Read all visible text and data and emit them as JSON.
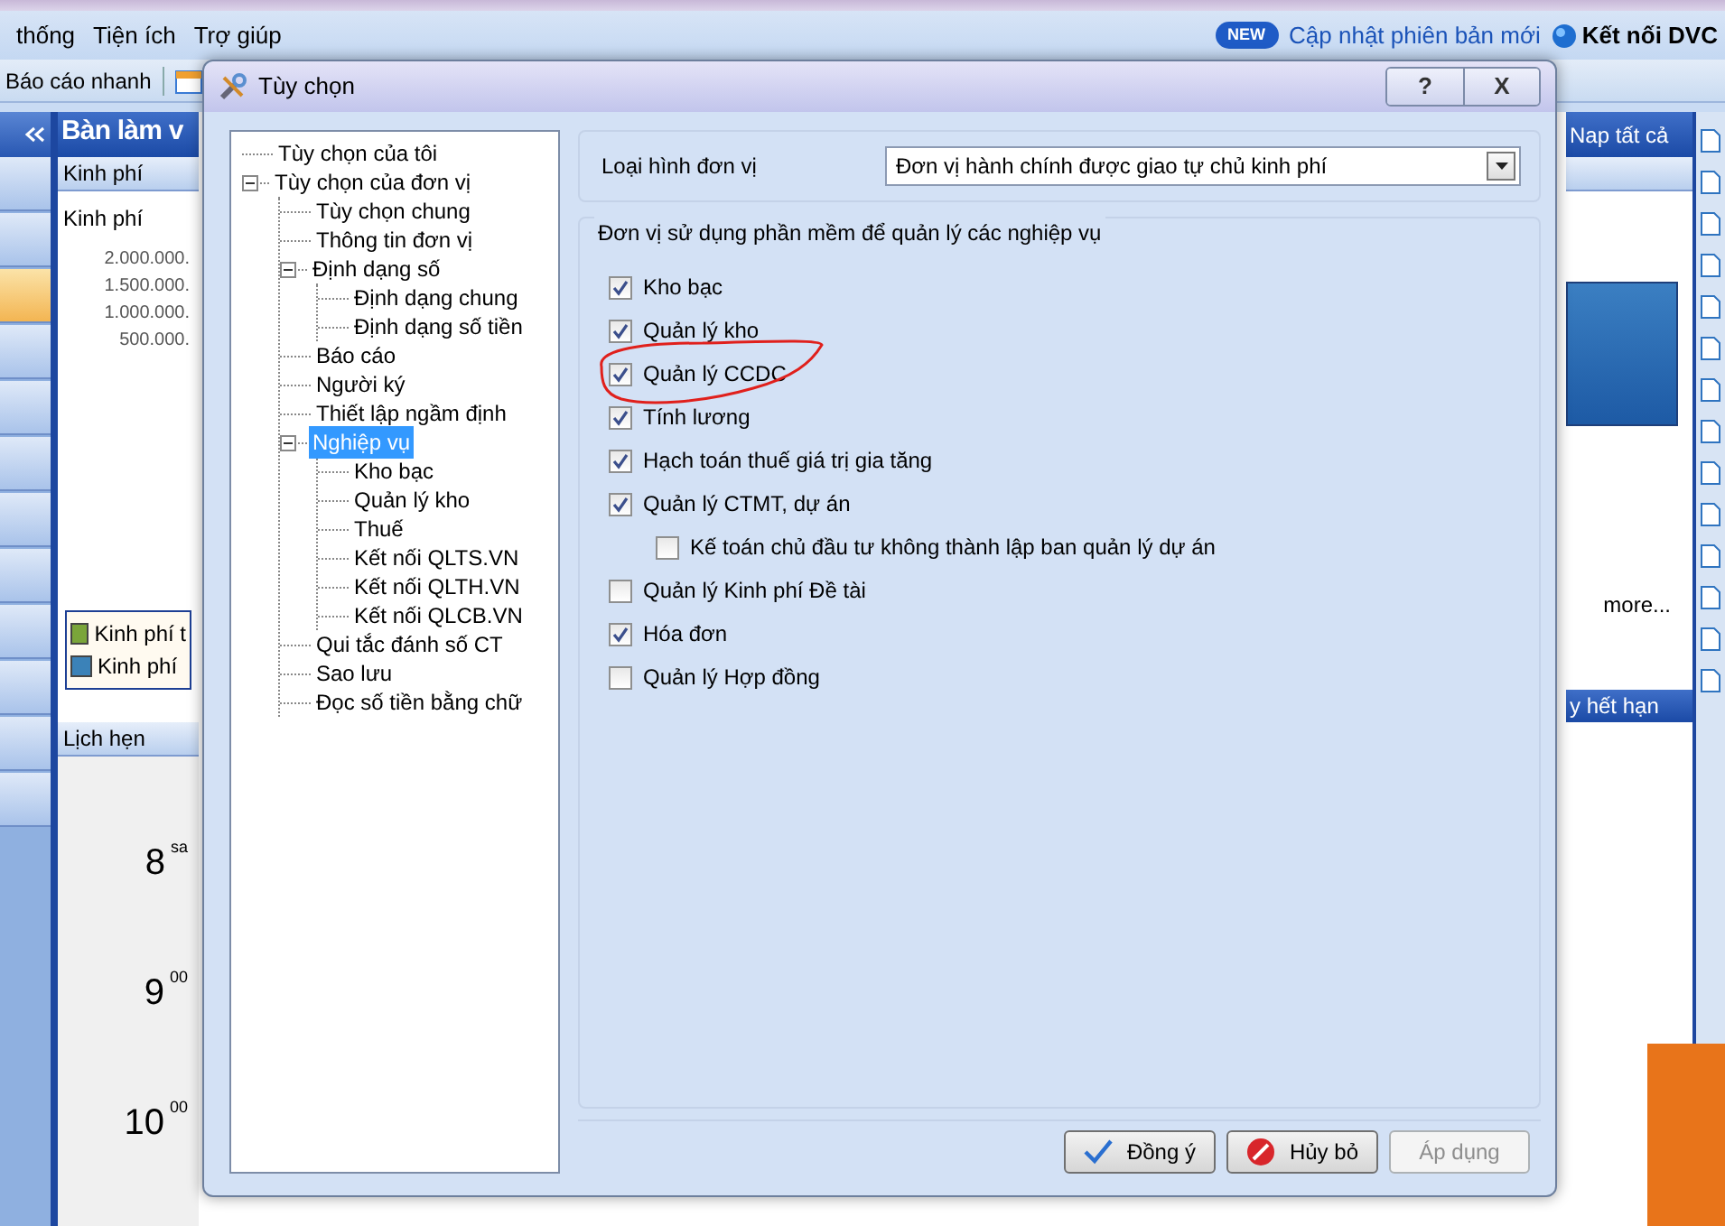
{
  "menu": [
    "thống",
    "Tiện ích",
    "Trợ giúp"
  ],
  "toolbar": {
    "quick_report": "Báo cáo nhanh"
  },
  "top_right": {
    "new_badge": "NEW",
    "update_link": "Cập nhật phiên bản mới",
    "connect": "Kết nối DVC"
  },
  "nav_tiles": [
    {
      "selected": false
    },
    {
      "selected": false
    },
    {
      "selected": true
    },
    {
      "selected": false
    },
    {
      "selected": false
    },
    {
      "selected": false
    },
    {
      "selected": false
    },
    {
      "selected": false
    },
    {
      "selected": false
    },
    {
      "selected": false
    },
    {
      "selected": false
    },
    {
      "selected": false
    }
  ],
  "workspace": {
    "title": "Bàn làm v",
    "load_all": "Nap tất cả",
    "budget_panel": {
      "header": "Kinh phí",
      "chart_title": "Kinh phí",
      "y_labels": [
        "2.000.000.",
        "1.500.000.",
        "1.000.000.",
        "500.000."
      ],
      "legend": [
        {
          "label": "Kinh phí t",
          "color": "#7aa53a"
        },
        {
          "label": "Kinh phí",
          "color": "#3b82b8"
        }
      ],
      "more": "more..."
    },
    "appointments": {
      "header": "Lịch hẹn",
      "hours": [
        {
          "hour": "8",
          "suffix": "sa"
        },
        {
          "hour": "9",
          "suffix": "00"
        },
        {
          "hour": "10",
          "suffix": "00"
        }
      ]
    },
    "expiry_header": "y hết hạn"
  },
  "dialog": {
    "title": "Tùy chọn",
    "help": "?",
    "close": "X",
    "tree": [
      {
        "label": "Tùy chọn của tôi",
        "selected": false
      },
      {
        "label": "Tùy chọn của đơn vị",
        "selected": false,
        "expanded": true,
        "children": [
          {
            "label": "Tùy chọn chung",
            "selected": false
          },
          {
            "label": "Thông tin đơn vị",
            "selected": false
          },
          {
            "label": "Định dạng số",
            "selected": false,
            "expanded": true,
            "children": [
              {
                "label": "Định dạng chung",
                "selected": false
              },
              {
                "label": "Định dạng số tiền",
                "selected": false
              }
            ]
          },
          {
            "label": "Báo cáo",
            "selected": false
          },
          {
            "label": "Người ký",
            "selected": false
          },
          {
            "label": "Thiết lập ngầm định",
            "selected": false
          },
          {
            "label": "Nghiệp vụ",
            "selected": true,
            "expanded": true,
            "children": [
              {
                "label": "Kho bạc",
                "selected": false
              },
              {
                "label": "Quản lý kho",
                "selected": false
              },
              {
                "label": "Thuế",
                "selected": false
              },
              {
                "label": "Kết nối QLTS.VN",
                "selected": false
              },
              {
                "label": "Kết nối QLTH.VN",
                "selected": false
              },
              {
                "label": "Kết nối QLCB.VN",
                "selected": false
              }
            ]
          },
          {
            "label": "Qui tắc đánh số CT",
            "selected": false
          },
          {
            "label": "Sao lưu",
            "selected": false
          },
          {
            "label": "Đọc số tiền bằng chữ",
            "selected": false
          }
        ]
      }
    ],
    "unit_type": {
      "label": "Loại hình đơn vị",
      "value": "Đơn vị hành chính được giao tự chủ kinh phí"
    },
    "group_title": "Đơn vị sử dụng phần mềm để quản lý các nghiệp vụ",
    "options": [
      {
        "label": "Kho bạc",
        "checked": true,
        "circled": false
      },
      {
        "label": "Quản lý kho",
        "checked": true,
        "circled": false
      },
      {
        "label": "Quản lý CCDC",
        "checked": true,
        "circled": true
      },
      {
        "label": "Tính lương",
        "checked": true,
        "circled": false
      },
      {
        "label": "Hạch toán thuế giá trị gia tăng",
        "checked": true,
        "circled": false
      },
      {
        "label": "Quản lý CTMT, dự án",
        "checked": true,
        "circled": false,
        "children": [
          {
            "label": "Kế toán chủ đầu tư không thành lập ban quản lý dự án",
            "checked": false,
            "circled": false
          }
        ]
      },
      {
        "label": "Quản lý Kinh phí Đề tài",
        "checked": false,
        "circled": false
      },
      {
        "label": "Hóa đơn",
        "checked": true,
        "circled": false
      },
      {
        "label": "Quản lý Hợp đồng",
        "checked": false,
        "circled": false
      }
    ],
    "buttons": [
      {
        "label": "Đồng ý",
        "kind": "ok",
        "disabled": false
      },
      {
        "label": "Hủy bỏ",
        "kind": "cancel",
        "disabled": false
      },
      {
        "label": "Áp dụng",
        "kind": "plain",
        "disabled": true
      }
    ]
  }
}
